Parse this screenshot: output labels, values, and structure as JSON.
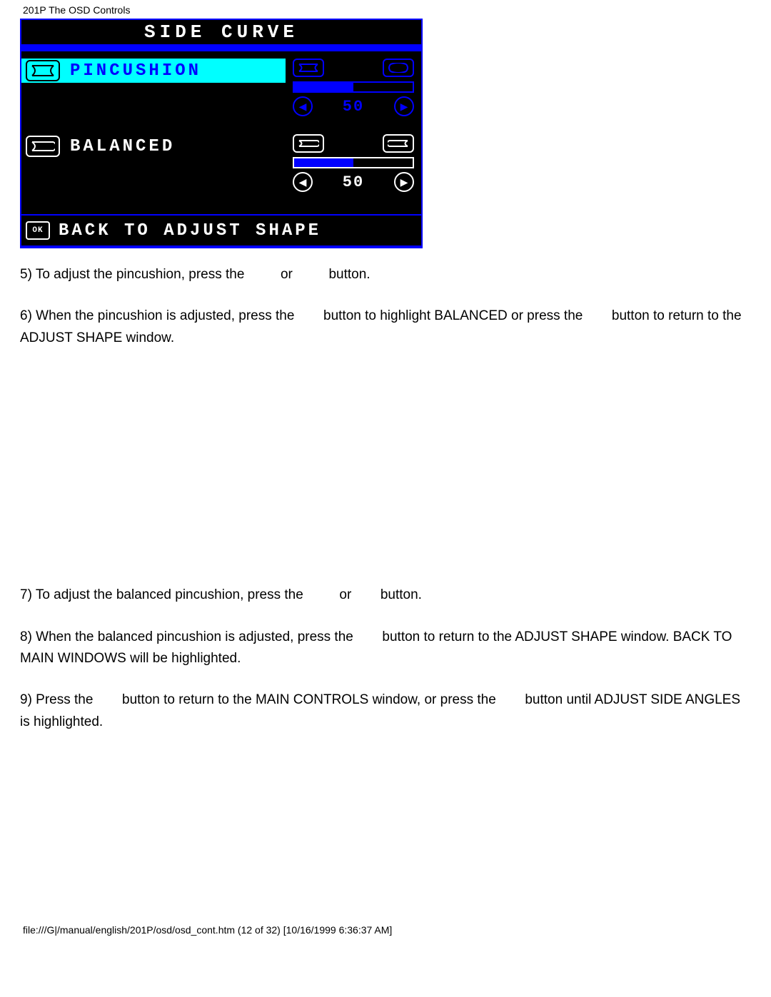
{
  "header": "201P The OSD Controls",
  "osd": {
    "title": "SIDE CURVE",
    "rows": [
      {
        "label": "PINCUSHION",
        "value": "50",
        "fill_pct": 50,
        "selected": true
      },
      {
        "label": "BALANCED",
        "value": "50",
        "fill_pct": 50,
        "selected": false
      }
    ],
    "footer_ok": "OK",
    "footer_text": "BACK TO ADJUST SHAPE"
  },
  "steps": {
    "s5a": "5) To adjust the pincushion, press the ",
    "s5b": " or ",
    "s5c": " button.",
    "s6a": "6) When the pincushion is adjusted, press the ",
    "s6b": " button to highlight BALANCED or press the ",
    "s6c": " button to return to the ADJUST SHAPE window.",
    "s7a": "7) To adjust the balanced pincushion, press the ",
    "s7b": " or ",
    "s7c": " button.",
    "s8a": "8) When the balanced pincushion is adjusted, press the ",
    "s8b": " button to return to the ADJUST SHAPE window. BACK TO MAIN WINDOWS will be highlighted.",
    "s9a": "9) Press the ",
    "s9b": " button to return to the MAIN CONTROLS window, or press the ",
    "s9c": " button until ADJUST SIDE ANGLES is highlighted."
  },
  "footer": "file:///G|/manual/english/201P/osd/osd_cont.htm (12 of 32) [10/16/1999 6:36:37 AM]"
}
